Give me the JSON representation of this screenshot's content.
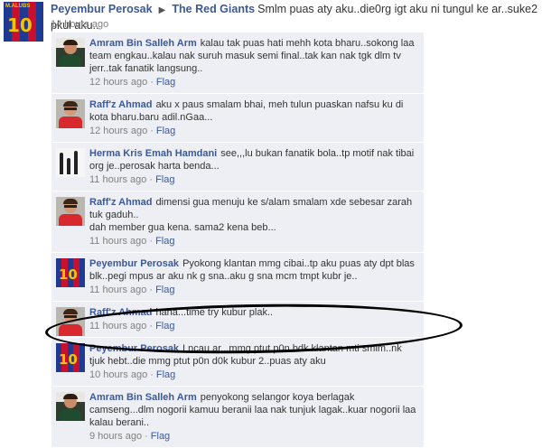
{
  "post": {
    "author": "Peyembur Perosak",
    "arrow": "▶",
    "target": "The Red Giants",
    "text": "Smlm puas aty aku..die0rg igt aku ni tungul ke ar..suke2 pkul aku..",
    "time": "14 hours ago",
    "avatar": {
      "number": "10",
      "name": "M.ALUBS"
    }
  },
  "comments": [
    {
      "author": "Amram Bin Salleh Arm",
      "text": "kalau tak puas hati mehh kota bharu..sokong laa team engkau..kalau nak suruh masuk semi final..tak kan nak tgk dlm tv jerr..tak fanatik langsung..",
      "time": "12 hours ago",
      "flag": "Flag",
      "avatar_type": "face"
    },
    {
      "author": "Raff'z Ahmad",
      "text": "aku x paus smalam bhai, meh tulun puaskan nafsu ku di kota bharu.baru adil.nGaa...",
      "time": "12 hours ago",
      "flag": "Flag",
      "avatar_type": "red"
    },
    {
      "author": "Herma Kris Emah Hamdani",
      "text": "see,,,lu bukan fanatik bola..tp motif nak tibai org je..perosak harta benda...",
      "time": "11 hours ago",
      "flag": "Flag",
      "avatar_type": "bottles"
    },
    {
      "author": "Raff'z Ahmad",
      "text": "dimensi gua menuju ke s/alam smalam xde sebesar zarah tuk gaduh..\ndah member gua kena. sama2 kena beb...",
      "time": "11 hours ago",
      "flag": "Flag",
      "avatar_type": "red"
    },
    {
      "author": "Peyembur Perosak",
      "text": "Pyokong klantan mmg cibai..tp aku puas aty dpt blas blk..pegi mpus ar aku nk g sna..aku g sna mcm tmpt kubr je..",
      "time": "11 hours ago",
      "flag": "Flag",
      "avatar_type": "jersey"
    },
    {
      "author": "Raff'z Ahmad",
      "text": "haha...time try kubur plak..",
      "time": "11 hours ago",
      "flag": "Flag",
      "avatar_type": "red"
    },
    {
      "author": "Peyembur Perosak",
      "text": "Lncau ar...mmg ptut p0n bdk klantan mti smlm..nk tjuk hebt..die mmg ptut p0n d0k kubur 2..puas aty aku",
      "time": "10 hours ago",
      "flag": "Flag",
      "avatar_type": "jersey"
    },
    {
      "author": "Amram Bin Salleh Arm",
      "text": "penyokong selangor koya berlagak camseng...dlm nogorii kamuu beranii laa nak tunjuk lagak..kuar nogorii laa kalau berani..",
      "time": "9 hours ago",
      "flag": "Flag",
      "avatar_type": "face"
    }
  ],
  "meta_separator": "·"
}
